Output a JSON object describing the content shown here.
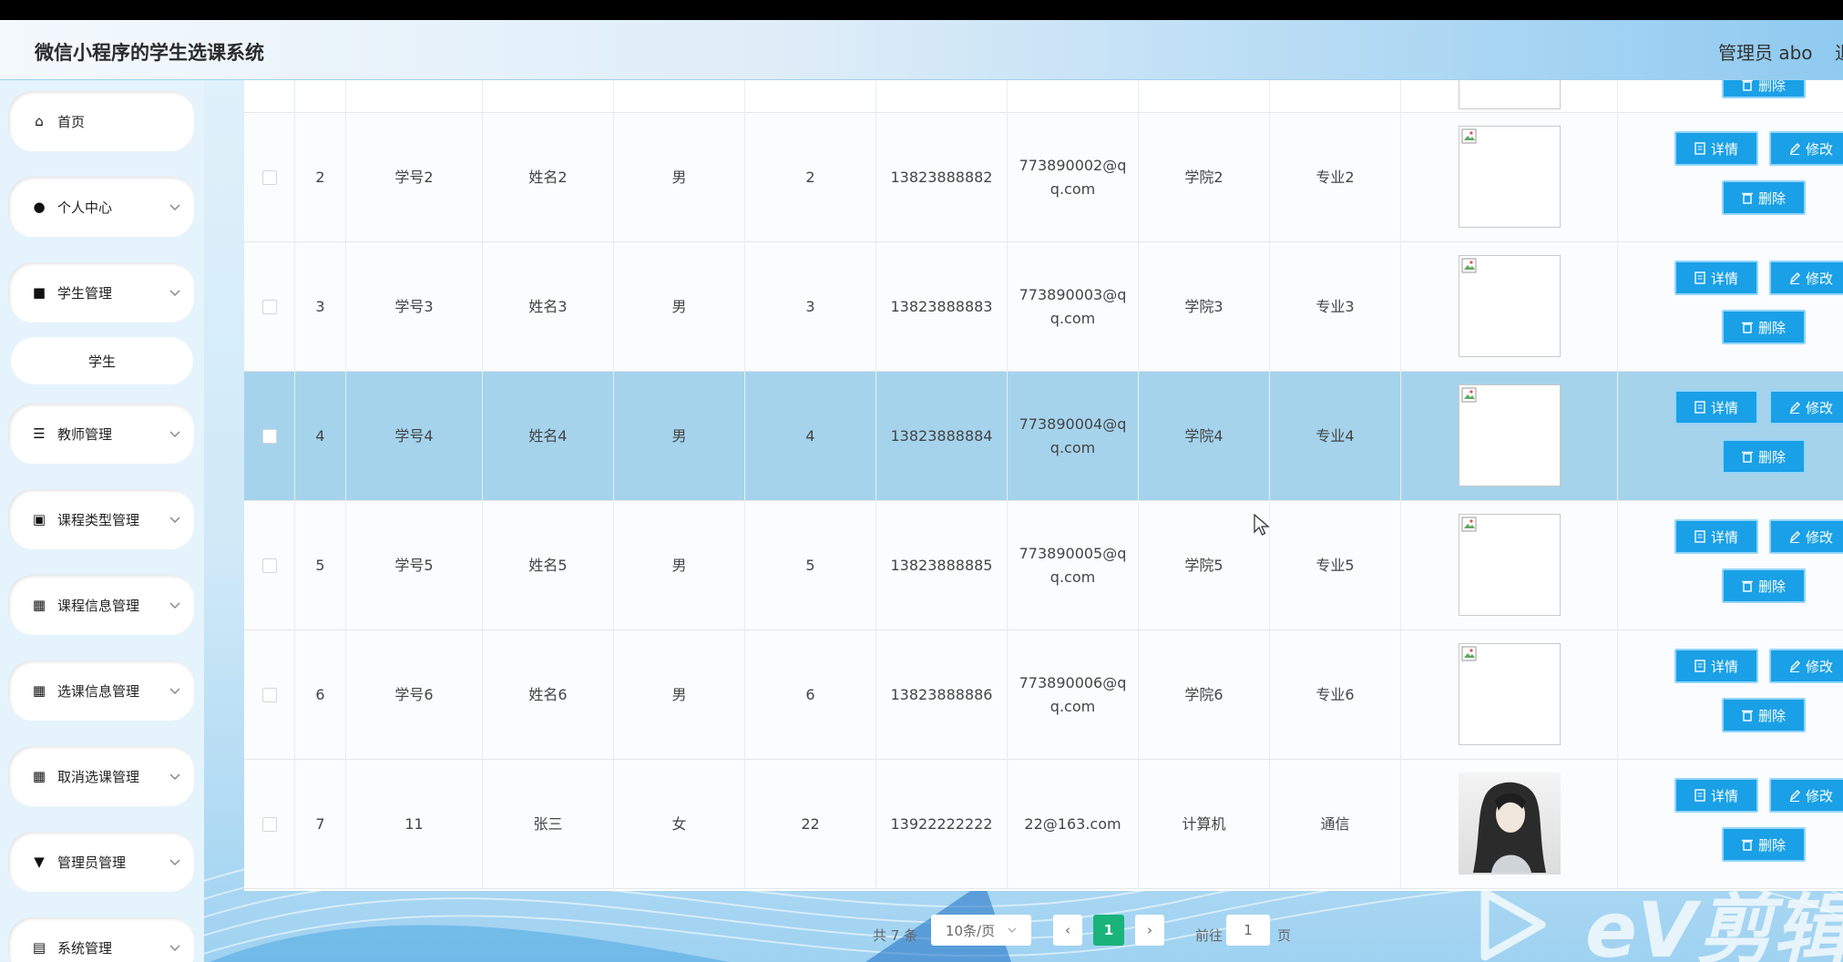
{
  "header": {
    "title": "微信小程序的学生选课系统",
    "admin": "管理员 abo",
    "logout_fragment": "退"
  },
  "sidebar": {
    "items": [
      {
        "label": "首页",
        "icon": "home-icon",
        "glyph": "⌂"
      },
      {
        "label": "个人中心",
        "icon": "user-icon",
        "glyph": "●"
      },
      {
        "label": "学生管理",
        "icon": "briefcase-icon",
        "glyph": "■"
      },
      {
        "label": "教师管理",
        "icon": "sliders-icon",
        "glyph": "☰"
      },
      {
        "label": "课程类型管理",
        "icon": "clipboard-icon",
        "glyph": "▣"
      },
      {
        "label": "课程信息管理",
        "icon": "grid-icon",
        "glyph": "▦"
      },
      {
        "label": "选课信息管理",
        "icon": "grid-icon",
        "glyph": "▦"
      },
      {
        "label": "取消选课管理",
        "icon": "grid-icon",
        "glyph": "▦"
      },
      {
        "label": "管理员管理",
        "icon": "podium-icon",
        "glyph": "▼"
      },
      {
        "label": "系统管理",
        "icon": "document-icon",
        "glyph": "▤"
      }
    ],
    "submenu": {
      "label": "学生"
    }
  },
  "table": {
    "top_row_button": "删除",
    "rows": [
      {
        "index": "2",
        "student_no": "学号2",
        "name": "姓名2",
        "gender": "男",
        "age": "2",
        "phone": "13823888882",
        "email_line1": "773890002@q",
        "email_line2": "q.com",
        "college": "学院2",
        "major": "专业2",
        "photo": "broken"
      },
      {
        "index": "3",
        "student_no": "学号3",
        "name": "姓名3",
        "gender": "男",
        "age": "3",
        "phone": "13823888883",
        "email_line1": "773890003@q",
        "email_line2": "q.com",
        "college": "学院3",
        "major": "专业3",
        "photo": "broken"
      },
      {
        "index": "4",
        "student_no": "学号4",
        "name": "姓名4",
        "gender": "男",
        "age": "4",
        "phone": "13823888884",
        "email_line1": "773890004@q",
        "email_line2": "q.com",
        "college": "学院4",
        "major": "专业4",
        "photo": "broken",
        "highlighted": true
      },
      {
        "index": "5",
        "student_no": "学号5",
        "name": "姓名5",
        "gender": "男",
        "age": "5",
        "phone": "13823888885",
        "email_line1": "773890005@q",
        "email_line2": "q.com",
        "college": "学院5",
        "major": "专业5",
        "photo": "broken"
      },
      {
        "index": "6",
        "student_no": "学号6",
        "name": "姓名6",
        "gender": "男",
        "age": "6",
        "phone": "13823888886",
        "email_line1": "773890006@q",
        "email_line2": "q.com",
        "college": "学院6",
        "major": "专业6",
        "photo": "broken"
      },
      {
        "index": "7",
        "student_no": "11",
        "name": "张三",
        "gender": "女",
        "age": "22",
        "phone": "13922222222",
        "email_line1": "22@163.com",
        "email_line2": "",
        "college": "计算机",
        "major": "通信",
        "photo": "avatar"
      }
    ],
    "buttons": {
      "detail": "详情",
      "edit": "修改",
      "delete": "删除"
    }
  },
  "pagination": {
    "total": "共 7 条",
    "page_size": "10条/页",
    "prev": "‹",
    "current": "1",
    "next": "›",
    "goto_prefix": "前往",
    "goto_value": "1",
    "goto_suffix": "页"
  },
  "watermark": {
    "text": "eV剪辑"
  },
  "colors": {
    "button": "#1aa0e6",
    "highlight_row": "#a5d3ec",
    "active_page": "#1ab37a"
  }
}
